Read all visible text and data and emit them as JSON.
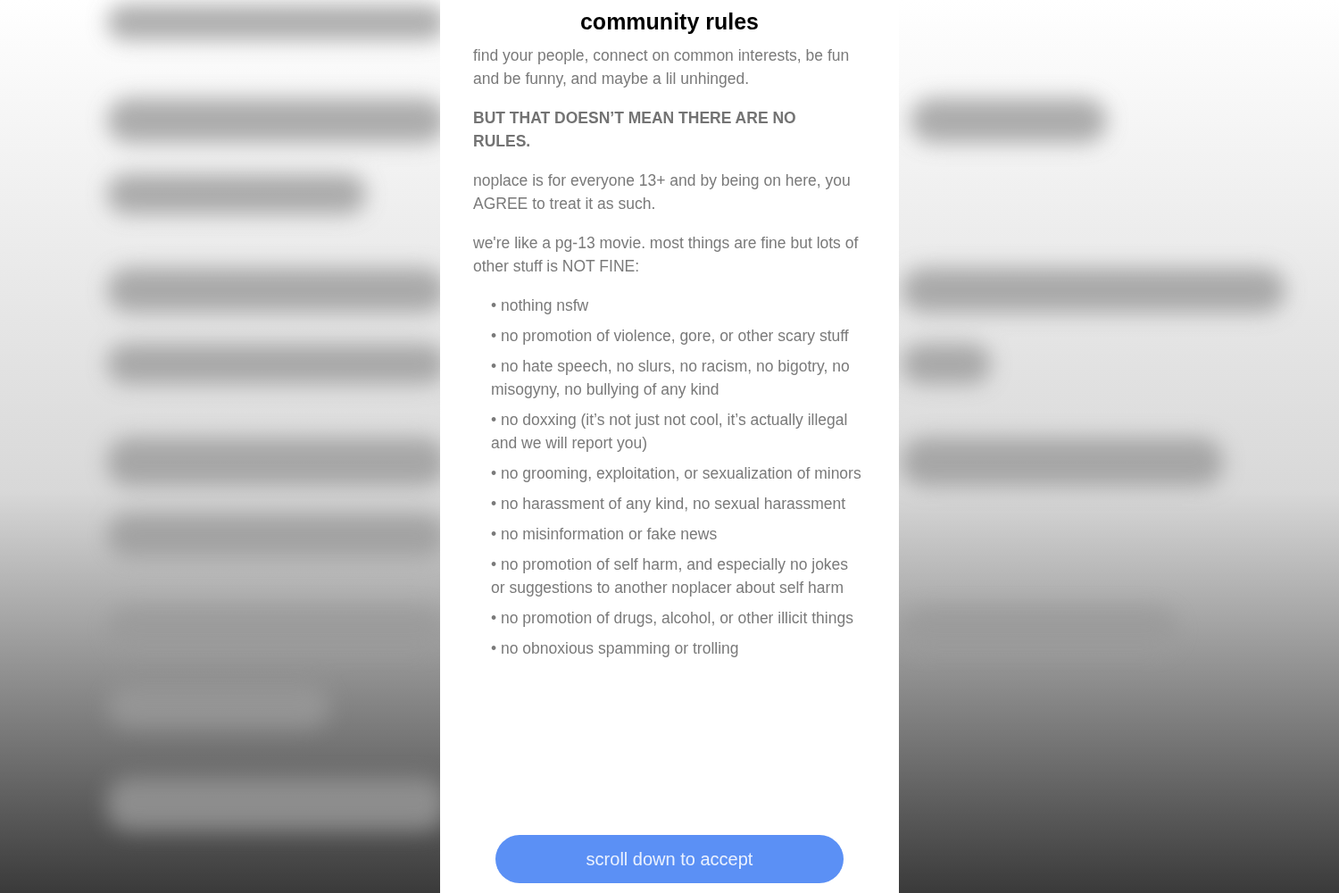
{
  "title": "community rules",
  "paragraphs": [
    {
      "kind": "text",
      "text": "find your people, connect on common interests, be fun and be funny, and maybe a lil unhinged."
    },
    {
      "kind": "heading",
      "text": "BUT THAT DOESN’T MEAN THERE ARE NO RULES."
    },
    {
      "kind": "text",
      "text": "noplace is for everyone 13+ and by being on here, you AGREE to treat it as such."
    },
    {
      "kind": "text",
      "text": "we're like a pg-13 movie. most things are fine but lots of other stuff is NOT FINE:"
    }
  ],
  "rules": [
    "• nothing nsfw",
    "• no promotion of violence, gore, or other scary stuff",
    "• no hate speech, no slurs, no racism, no bigotry, no misogyny, no bullying of any kind",
    "• no doxxing (it’s not just not cool, it’s actually illegal and we will report you)",
    "• no grooming, exploitation, or sexualization of minors",
    "• no harassment of any kind, no sexual harassment",
    "• no misinformation or fake news",
    "• no promotion of self harm, and especially no jokes or suggestions to another noplacer about self harm",
    "• no promotion of drugs, alcohol, or other illicit things",
    "• no obnoxious spamming or trolling"
  ],
  "button": {
    "label": "scroll down to accept"
  }
}
